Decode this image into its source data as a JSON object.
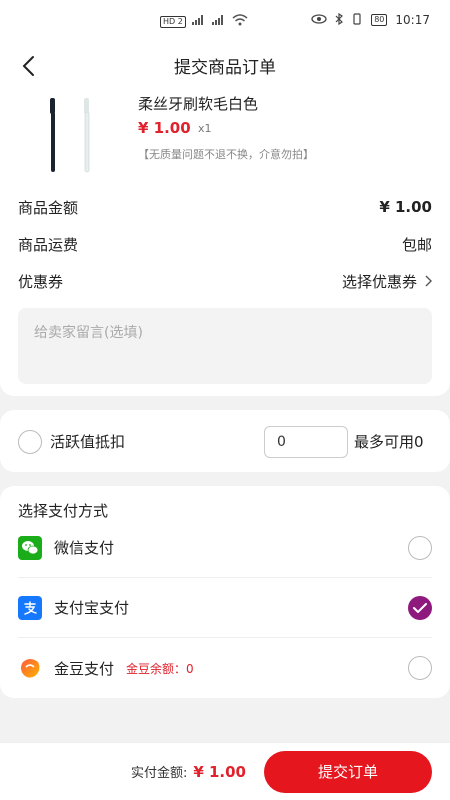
{
  "statusbar": {
    "time": "10:17",
    "signal_label": "HD 2",
    "battery": "80"
  },
  "header": {
    "title": "提交商品订单"
  },
  "product": {
    "name": "柔丝牙刷软毛白色",
    "price": "¥ 1.00",
    "qty": "x1",
    "note": "【无质量问题不退不换，介意勿拍】"
  },
  "summary": {
    "amount_label": "商品金额",
    "amount_value": "¥ 1.00",
    "shipping_label": "商品运费",
    "shipping_value": "包邮",
    "coupon_label": "优惠券",
    "coupon_value": "选择优惠券"
  },
  "message": {
    "placeholder": "给卖家留言(选填)"
  },
  "active": {
    "label": "活跃值抵扣",
    "input_value": "0",
    "max_text": "最多可用0"
  },
  "payment": {
    "title": "选择支付方式",
    "methods": [
      {
        "label": "微信支付",
        "icon": "wechat-icon",
        "selected": false
      },
      {
        "label": "支付宝支付",
        "icon": "alipay-icon",
        "selected": true
      },
      {
        "label": "金豆支付",
        "icon": "golden-bean-icon",
        "selected": false,
        "extra": "金豆余额：0"
      }
    ]
  },
  "footer": {
    "total_label": "实付金额:",
    "total_value": "¥ 1.00",
    "submit_label": "提交订单"
  },
  "colors": {
    "accent": "#e5161e",
    "price": "#e0222c",
    "selected_radio": "#8e1a7e",
    "wechat": "#1aad19",
    "alipay": "#1677ff"
  }
}
